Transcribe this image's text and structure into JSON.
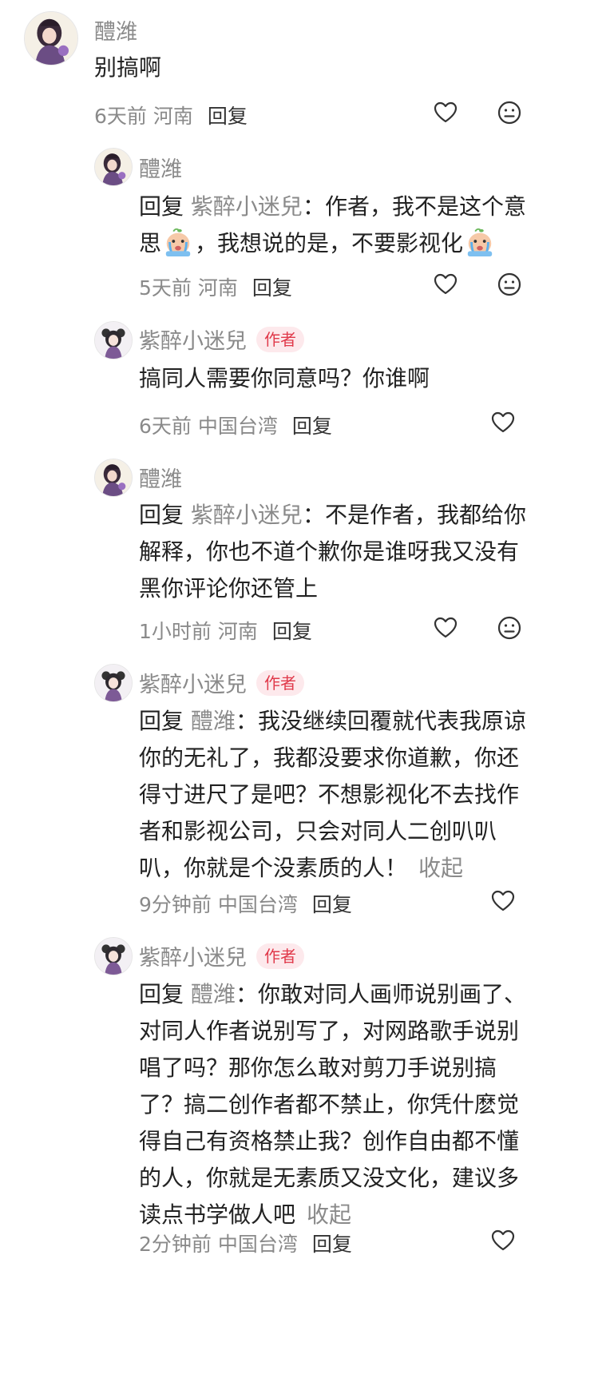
{
  "comments": [
    {
      "user": "醴潍",
      "is_author": false,
      "text": "别搞啊",
      "time": "6天前",
      "location": "河南",
      "reply_label": "回复",
      "has_dislike": true
    },
    {
      "user": "醴潍",
      "is_author": false,
      "reply_prefix": "回复",
      "reply_to": "紫醉小迷兒",
      "text_part1": "作者，我不是这个意思",
      "text_part2": "，我想说的是，不要影视化",
      "time": "5天前",
      "location": "河南",
      "reply_label": "回复",
      "has_dislike": true
    },
    {
      "user": "紫醉小迷兒",
      "is_author": true,
      "author_badge": "作者",
      "text": "搞同人需要你同意吗？你谁啊",
      "time": "6天前",
      "location": "中国台湾",
      "reply_label": "回复",
      "has_dislike": false
    },
    {
      "user": "醴潍",
      "is_author": false,
      "reply_prefix": "回复",
      "reply_to": "紫醉小迷兒",
      "text": "不是作者，我都给你解释，你也不道个歉你是谁呀我又没有黑你评论你还管上",
      "time": "1小时前",
      "location": "河南",
      "reply_label": "回复",
      "has_dislike": true
    },
    {
      "user": "紫醉小迷兒",
      "is_author": true,
      "author_badge": "作者",
      "reply_prefix": "回复",
      "reply_to": "醴潍",
      "text": "我没继续回覆就代表我原谅你的无礼了，我都没要求你道歉，你还得寸进尺了是吧？不想影视化不去找作者和影视公司，只会对同人二创叭叭叭，你就是个没素质的人！",
      "collapse": "收起",
      "time": "9分钟前",
      "location": "中国台湾",
      "reply_label": "回复",
      "has_dislike": false
    },
    {
      "user": "紫醉小迷兒",
      "is_author": true,
      "author_badge": "作者",
      "reply_prefix": "回复",
      "reply_to": "醴潍",
      "text": "你敢对同人画师说别画了、对同人作者说别写了，对网路歌手说别唱了吗？那你怎么敢对剪刀手说别搞了？搞二创作者都不禁止，你凭什麽觉得自己有资格禁止我？创作自由都不懂的人，你就是无素质又没文化，建议多读点书学做人吧",
      "collapse": "收起",
      "time": "2分钟前",
      "location": "中国台湾",
      "reply_label": "回复",
      "has_dislike": false
    }
  ],
  "colors": {
    "name": "#8a8a8a",
    "badge_text": "#e0394a",
    "badge_bg": "#fde9ec",
    "body_text": "#222222"
  },
  "icons": {
    "like": "heart-outline-icon",
    "dislike": "meh-face-icon"
  }
}
